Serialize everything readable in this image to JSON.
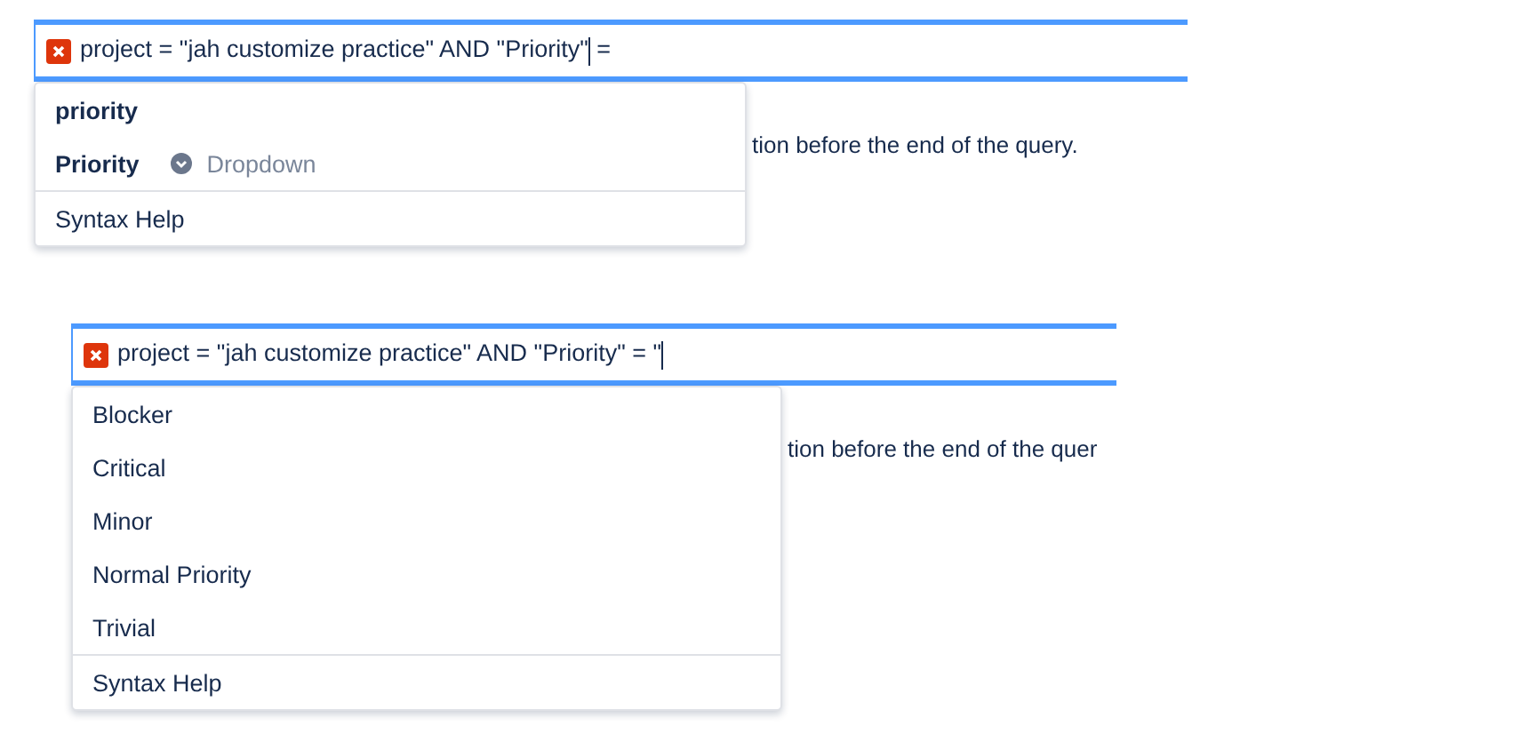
{
  "searches": [
    {
      "invalid": true,
      "query_before_caret": "project = \"jah customize practice\" AND \"Priority\"",
      "query_after_caret": " =",
      "error": "tion before the end of the query.",
      "suggestions": [
        {
          "kind": "field",
          "label": "priority"
        },
        {
          "kind": "field",
          "label": "Priority",
          "type": "Dropdown"
        }
      ],
      "footer": "Syntax Help"
    },
    {
      "invalid": true,
      "query_before_caret": "project = \"jah customize practice\" AND \"Priority\" = \"",
      "error": "tion before the end of the quer",
      "suggestions": [
        {
          "kind": "value",
          "label": "Blocker"
        },
        {
          "kind": "value",
          "label": "Critical"
        },
        {
          "kind": "value",
          "label": "Minor"
        },
        {
          "kind": "value",
          "label": "Normal Priority"
        },
        {
          "kind": "value",
          "label": "Trivial"
        }
      ],
      "footer": "Syntax Help"
    }
  ]
}
